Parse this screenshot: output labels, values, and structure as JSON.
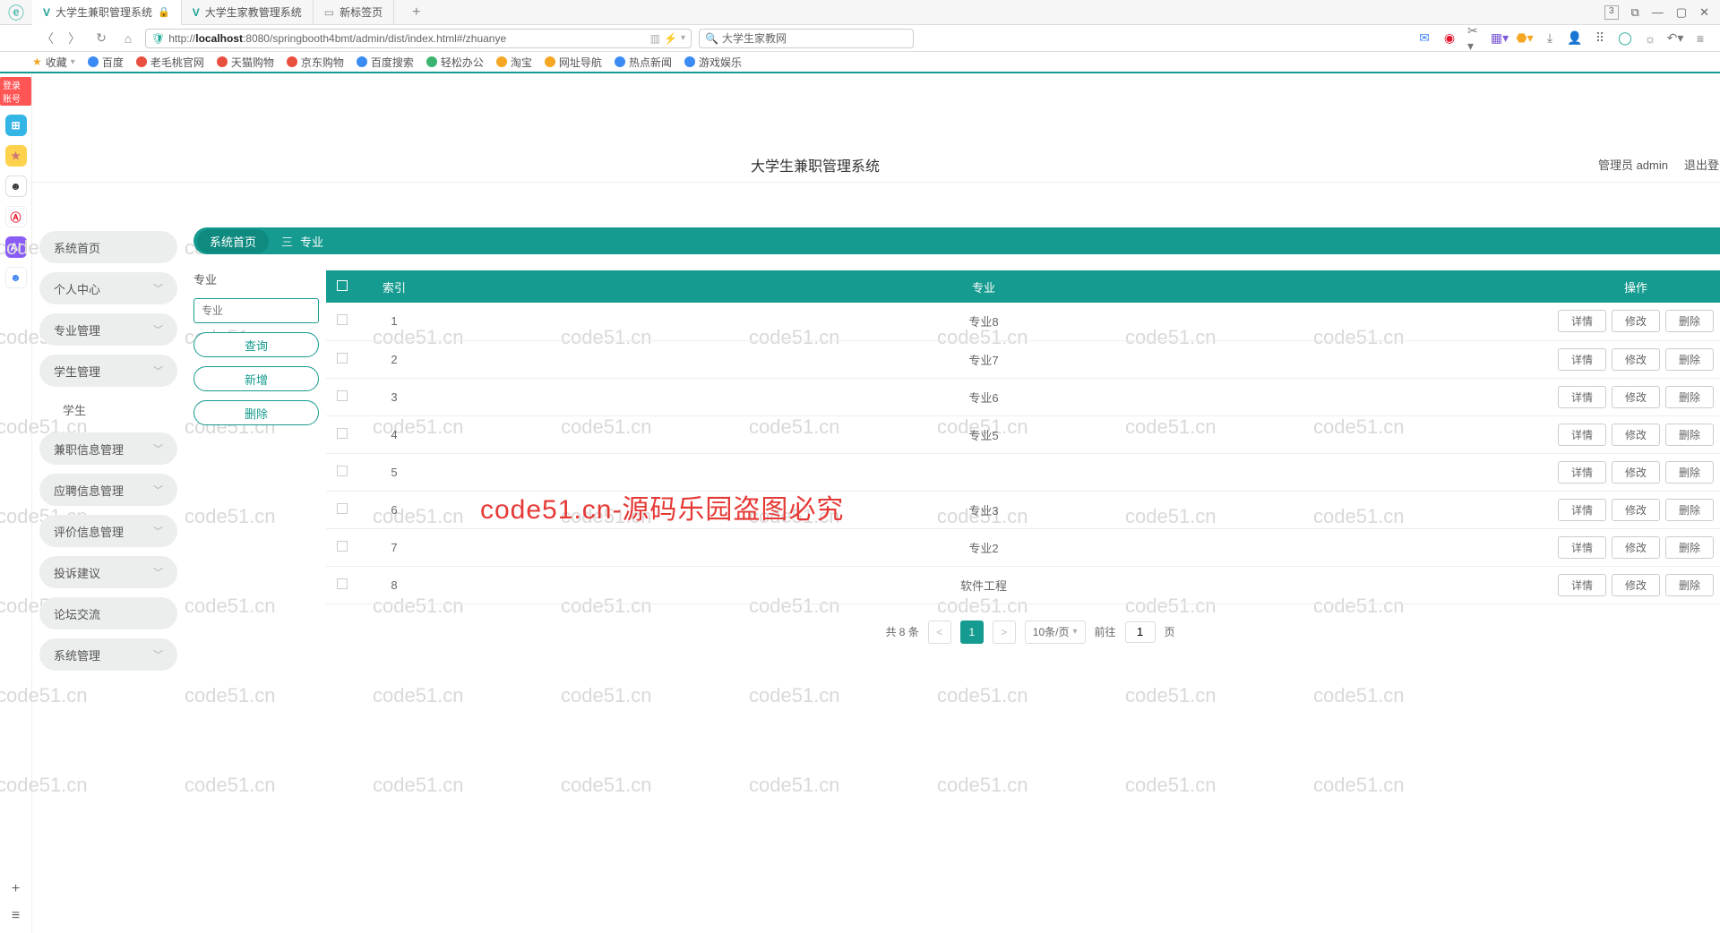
{
  "browser": {
    "tabs": [
      {
        "icon": "V",
        "title": "大学生兼职管理系统",
        "locked": true,
        "active": true
      },
      {
        "icon": "V",
        "title": "大学生家教管理系统",
        "active": false
      },
      {
        "icon": "▭",
        "title": "新标签页",
        "active": false
      }
    ],
    "win_badge": "3",
    "url_prefix": "http://",
    "url_host": "localhost",
    "url_rest": ":8080/springbooth4bmt/admin/dist/index.html#/zhuanye",
    "search_placeholder": "大学生家教网",
    "bookmarks": [
      "收藏",
      "百度",
      "老毛桃官网",
      "天猫购物",
      "京东购物",
      "百度搜索",
      "轻松办公",
      "淘宝",
      "网址导航",
      "热点新闻",
      "游戏娱乐"
    ]
  },
  "rail": {
    "badge": "登录账号"
  },
  "header": {
    "title": "大学生兼职管理系统",
    "admin": "管理员 admin",
    "logout": "退出登录"
  },
  "sidebar": {
    "items": [
      {
        "label": "系统首页",
        "expand": false
      },
      {
        "label": "个人中心",
        "expand": true
      },
      {
        "label": "专业管理",
        "expand": true
      },
      {
        "label": "学生管理",
        "expand": true,
        "sub": "学生"
      },
      {
        "label": "兼职信息管理",
        "expand": true
      },
      {
        "label": "应聘信息管理",
        "expand": true
      },
      {
        "label": "评价信息管理",
        "expand": true
      },
      {
        "label": "投诉建议",
        "expand": true
      },
      {
        "label": "论坛交流",
        "expand": false
      },
      {
        "label": "系统管理",
        "expand": true
      }
    ]
  },
  "crumb": {
    "home": "系统首页",
    "sep": "三",
    "current": "专业"
  },
  "filter": {
    "label": "专业",
    "placeholder": "专业",
    "query": "查询",
    "add": "新增",
    "del": "删除"
  },
  "table": {
    "headers": {
      "index": "索引",
      "major": "专业",
      "ops": "操作"
    },
    "op_labels": {
      "detail": "详情",
      "edit": "修改",
      "del": "删除"
    },
    "rows": [
      {
        "idx": "1",
        "major": "专业8"
      },
      {
        "idx": "2",
        "major": "专业7"
      },
      {
        "idx": "3",
        "major": "专业6"
      },
      {
        "idx": "4",
        "major": "专业5"
      },
      {
        "idx": "5",
        "major": ""
      },
      {
        "idx": "6",
        "major": "专业3"
      },
      {
        "idx": "7",
        "major": "专业2"
      },
      {
        "idx": "8",
        "major": "软件工程"
      }
    ]
  },
  "pager": {
    "total": "共 8 条",
    "prev": "<",
    "page": "1",
    "next": ">",
    "size": "10条/页",
    "goto_pre": "前往",
    "goto_val": "1",
    "goto_post": "页"
  },
  "watermark": {
    "text": "code51.cn",
    "red": "code51.cn-源码乐园盗图必究"
  }
}
